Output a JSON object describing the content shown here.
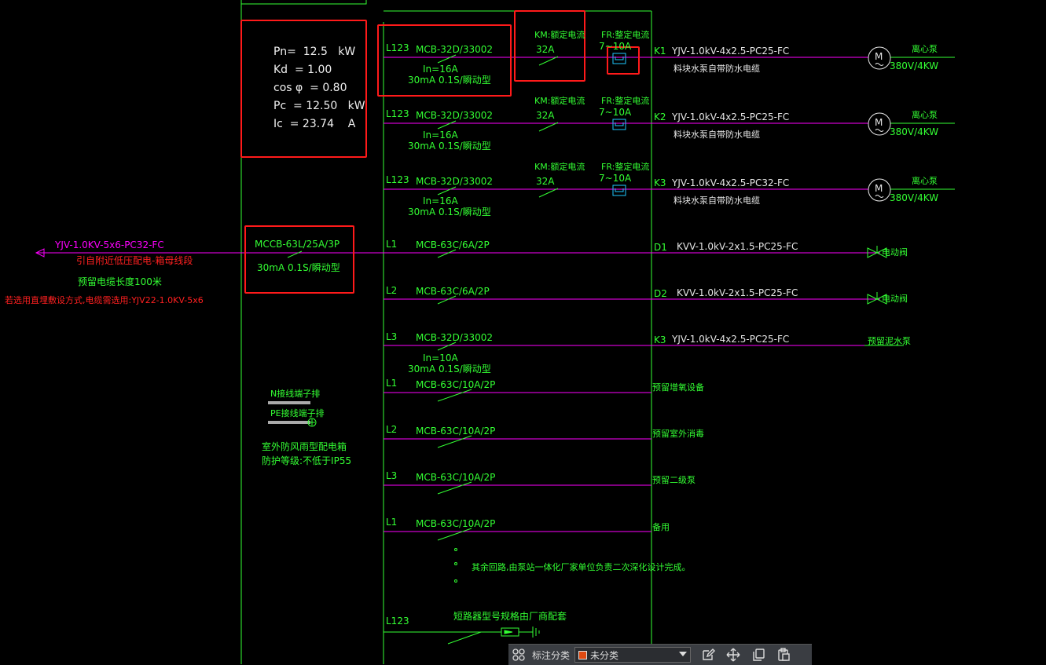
{
  "params": {
    "pn": "Pn=  12.5   kW",
    "kd": "Kd  = 1.00",
    "cos": "cos φ  = 0.80",
    "pc": "Pc  = 12.50   kW",
    "ic": "Ic  = 23.74    A"
  },
  "incoming": {
    "cable": "YJV-1.0KV-5x6-PC32-FC",
    "note1": "引自附近低压配电-箱母线段",
    "note2": "预留电缆长度100米",
    "note3": "若选用直埋敷设方式,电缆需选用:YJV22-1.0KV-5x6",
    "breaker": "MCCB-63L/25A/3P",
    "breaker_rcd": "30mA 0.1S/瞬动型"
  },
  "pump_circuits": [
    {
      "phase": "L123",
      "breaker": "MCB-32D/33002",
      "in": "In=16A",
      "rcd": "30mA 0.1S/瞬动型",
      "km": "KM:额定电流",
      "km_val": "32A",
      "fr": "FR:整定电流",
      "fr_val": "7~10A",
      "id": "K1",
      "cable": "YJV-1.0kV-4x2.5-PC25-FC",
      "desc": "料块水泵自带防水电缆",
      "motor": "M",
      "load": "离心泵",
      "rating": "380V/4KW"
    },
    {
      "phase": "L123",
      "breaker": "MCB-32D/33002",
      "in": "In=16A",
      "rcd": "30mA 0.1S/瞬动型",
      "km": "KM:额定电流",
      "km_val": "32A",
      "fr": "FR:整定电流",
      "fr_val": "7~10A",
      "id": "K2",
      "cable": "YJV-1.0kV-4x2.5-PC25-FC",
      "desc": "料块水泵自带防水电缆",
      "motor": "M",
      "load": "离心泵",
      "rating": "380V/4KW"
    },
    {
      "phase": "L123",
      "breaker": "MCB-32D/33002",
      "in": "In=16A",
      "rcd": "30mA 0.1S/瞬动型",
      "km": "KM:额定电流",
      "km_val": "32A",
      "fr": "FR:整定电流",
      "fr_val": "7~10A",
      "id": "K3",
      "cable": "YJV-1.0kV-4x2.5-PC32-FC",
      "desc": "料块水泵自带防水电缆",
      "motor": "M",
      "load": "离心泵",
      "rating": "380V/4KW"
    }
  ],
  "valve_circuits": [
    {
      "phase": "L1",
      "breaker": "MCB-63C/6A/2P",
      "id": "D1",
      "cable": "KVV-1.0kV-2x1.5-PC25-FC",
      "load": "电动阀"
    },
    {
      "phase": "L2",
      "breaker": "MCB-63C/6A/2P",
      "id": "D2",
      "cable": "KVV-1.0kV-2x1.5-PC25-FC",
      "load": "电动阀"
    }
  ],
  "pump3_circuit": {
    "phase": "L3",
    "breaker": "MCB-32D/33002",
    "in": "In=10A",
    "rcd": "30mA 0.1S/瞬动型",
    "id": "K3",
    "cable": "YJV-1.0kV-4x2.5-PC25-FC",
    "load": "预留泥水泵"
  },
  "spare_circuits": [
    {
      "phase": "L1",
      "breaker": "MCB-63C/10A/2P",
      "load": "预留增氧设备"
    },
    {
      "phase": "L2",
      "breaker": "MCB-63C/10A/2P",
      "load": "预留室外消毒"
    },
    {
      "phase": "L3",
      "breaker": "MCB-63C/10A/2P",
      "load": "预留二级泵"
    },
    {
      "phase": "L1",
      "breaker": "MCB-63C/10A/2P",
      "load": "备用"
    }
  ],
  "other_note": "其余回路,由泵站一体化厂家单位负责二次深化设计完成。",
  "spd": {
    "phase": "L123",
    "label": "短路器型号规格由厂商配套"
  },
  "terminals": {
    "n": "N接线端子排",
    "pe": "PE接线端子排",
    "box1": "室外防风雨型配电箱",
    "box2": "防护等级:不低于IP55"
  },
  "toolbar": {
    "label": "标注分类",
    "selected": "未分类",
    "swatch_color": "#e04a12"
  },
  "colors": {
    "wire": "#ff00ff",
    "frame": "#33ff33",
    "highlight": "#ff1a1a",
    "cyan": "#1ec8ff"
  }
}
